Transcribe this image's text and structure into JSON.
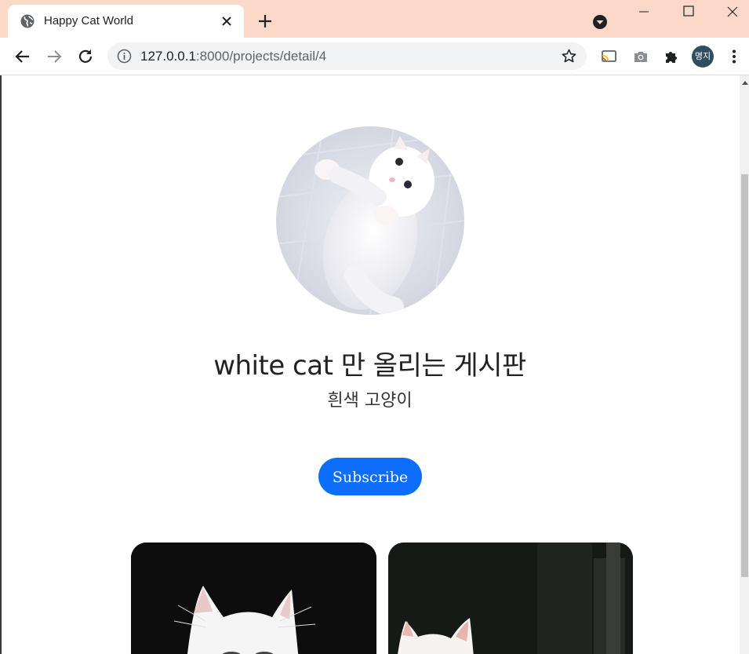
{
  "browser": {
    "tab_title": "Happy Cat World",
    "url_host": "127.0.0.1",
    "url_path": ":8000/projects/detail/4",
    "profile_label": "명지",
    "colors": {
      "titlebar": "#fbd8c7",
      "omnibox": "#f1f3f4"
    }
  },
  "page": {
    "title": "white cat 만 올리는 게시판",
    "subtitle": "흰색 고양이",
    "subscribe_label": "Subscribe",
    "accent": "#0d6efd"
  },
  "icons": {
    "favicon": "globe-icon",
    "tab_close": "close-icon",
    "new_tab": "plus-icon",
    "tab_search": "chevron-down-icon",
    "back": "back-arrow-icon",
    "forward": "forward-arrow-icon",
    "reload": "reload-icon",
    "info": "info-icon",
    "bookmark": "star-icon",
    "cast": "cast-icon",
    "screenshot": "camera-icon",
    "extensions": "puzzle-icon",
    "menu": "kebab-menu-icon"
  }
}
